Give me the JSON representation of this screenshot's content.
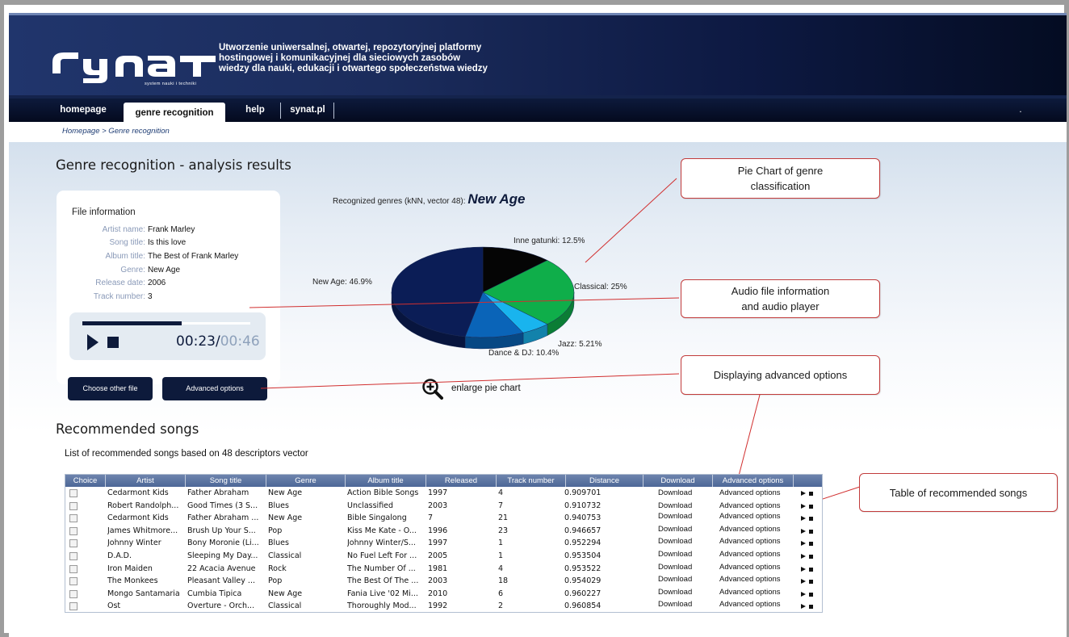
{
  "header": {
    "logo_text": "synat",
    "logo_subtitle": "system nauki i techniki",
    "tagline": [
      "Utworzenie uniwersalnej, otwartej, repozytoryjnej platformy",
      "hostingowej i komunikacyjnej dla sieciowych zasobów",
      "wiedzy dla nauki, edukacji i otwartego społeczeństwa wiedzy"
    ]
  },
  "nav": {
    "items": [
      "homepage",
      "genre recognition",
      "help",
      "synat.pl"
    ],
    "active": "genre recognition",
    "dot": "."
  },
  "breadcrumb": "Homepage > Genre recognition",
  "page_title": "Genre recognition - analysis results",
  "file_info": {
    "title": "File information",
    "rows": [
      {
        "label": "Artist name:",
        "value": "Frank Marley"
      },
      {
        "label": "Song title:",
        "value": "Is this love"
      },
      {
        "label": "Album title:",
        "value": "The Best of Frank Marley"
      },
      {
        "label": "Genre:",
        "value": "New Age"
      },
      {
        "label": "Release date:",
        "value": "2006"
      },
      {
        "label": "Track number:",
        "value": "3"
      }
    ]
  },
  "player": {
    "progress": 0.59,
    "current_time": "00:23",
    "separator": "/",
    "duration": "00:46"
  },
  "buttons": {
    "choose_file": "Choose other file",
    "advanced_options": "Advanced options"
  },
  "chart": {
    "recognized_prefix": "Recognized genres (kNN, vector 48):",
    "recognized_genre": "New Age",
    "enlarge_label": "enlarge pie chart"
  },
  "chart_data": {
    "type": "pie",
    "labels": [
      "Inne gatunki: 12.5%",
      "Classical: 25%",
      "Jazz: 5.21%",
      "Dance & DJ: 10.4%",
      "New Age: 46.9%"
    ],
    "categories": [
      "Inne gatunki",
      "Classical",
      "Jazz",
      "Dance & DJ",
      "New Age"
    ],
    "values": [
      12.5,
      25,
      5.21,
      10.4,
      46.9
    ],
    "colors": [
      "#050505",
      "#0fae4a",
      "#19b4ee",
      "#0a64b8",
      "#0b1d56"
    ]
  },
  "callouts": {
    "pie": [
      "Pie Chart of genre",
      "classification"
    ],
    "audio": [
      "Audio file information",
      "and audio player"
    ],
    "advanced": "Displaying advanced options",
    "table": "Table of recommended songs"
  },
  "recommended": {
    "title": "Recommended songs",
    "description": "List of recommended songs based on 48 descriptors vector",
    "columns": [
      "Choice",
      "Artist",
      "Song title",
      "Genre",
      "Album title",
      "Released",
      "Track number",
      "Distance",
      "Download",
      "Advanced options"
    ],
    "rows": [
      {
        "artist": "Cedarmont Kids",
        "song": "Father Abraham",
        "genre": "New Age",
        "album": "Action Bible Songs",
        "released": "1997",
        "track": "4",
        "distance": "0.909701"
      },
      {
        "artist": "Robert Randolph...",
        "song": "Good Times (3 S...",
        "genre": "Blues",
        "album": "Unclassified",
        "released": "2003",
        "track": "7",
        "distance": "0.910732"
      },
      {
        "artist": "Cedarmont Kids",
        "song": "Father Abraham ...",
        "genre": "New Age",
        "album": "Bible Singalong",
        "released": "7",
        "track": "21",
        "distance": "0.940753"
      },
      {
        "artist": "James Whitmore...",
        "song": "Brush Up Your S...",
        "genre": "Pop",
        "album": "Kiss Me Kate - O...",
        "released": "1996",
        "track": "23",
        "distance": "0.946657"
      },
      {
        "artist": "Johnny Winter",
        "song": "Bony Moronie (Li...",
        "genre": "Blues",
        "album": "Johnny Winter/S...",
        "released": "1997",
        "track": "1",
        "distance": "0.952294"
      },
      {
        "artist": "D.A.D.",
        "song": "Sleeping My Day...",
        "genre": "Classical",
        "album": "No Fuel Left For ...",
        "released": "2005",
        "track": "1",
        "distance": "0.953504"
      },
      {
        "artist": "Iron Maiden",
        "song": "22 Acacia Avenue",
        "genre": "Rock",
        "album": "The Number Of ...",
        "released": "1981",
        "track": "4",
        "distance": "0.953522"
      },
      {
        "artist": "The Monkees",
        "song": "Pleasant Valley ...",
        "genre": "Pop",
        "album": "The Best Of The ...",
        "released": "2003",
        "track": "18",
        "distance": "0.954029"
      },
      {
        "artist": "Mongo Santamaria",
        "song": "Cumbia Tipica",
        "genre": "New Age",
        "album": "Fania Live '02 Mi...",
        "released": "2010",
        "track": "6",
        "distance": "0.960227"
      },
      {
        "artist": "Ost",
        "song": "Overture - Orch...",
        "genre": "Classical",
        "album": "Thoroughly Mod...",
        "released": "1992",
        "track": "2",
        "distance": "0.960854"
      }
    ],
    "download_label": "Download",
    "advanced_label": "Advanced options"
  }
}
